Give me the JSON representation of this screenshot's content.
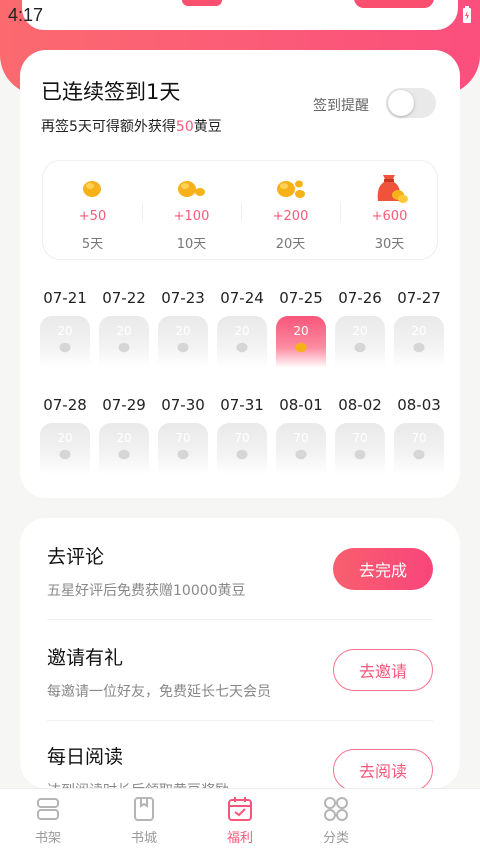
{
  "status_bar": {
    "time": "4:17"
  },
  "signin": {
    "title": "已连续签到1天",
    "subtitle_prefix": "再签5天可得额外获得",
    "subtitle_highlight": "50",
    "subtitle_suffix": "黄豆",
    "remind_label": "签到提醒",
    "remind_enabled": false,
    "rewards": [
      {
        "points": "+50",
        "days": "5天",
        "icon": "bean-small-icon"
      },
      {
        "points": "+100",
        "days": "10天",
        "icon": "bean-double-icon"
      },
      {
        "points": "+200",
        "days": "20天",
        "icon": "bean-triple-icon"
      },
      {
        "points": "+600",
        "days": "30天",
        "icon": "bean-bag-icon"
      }
    ],
    "calendar": [
      {
        "date": "07-21",
        "value": "20",
        "active": false
      },
      {
        "date": "07-22",
        "value": "20",
        "active": false
      },
      {
        "date": "07-23",
        "value": "20",
        "active": false
      },
      {
        "date": "07-24",
        "value": "20",
        "active": false
      },
      {
        "date": "07-25",
        "value": "20",
        "active": true
      },
      {
        "date": "07-26",
        "value": "20",
        "active": false
      },
      {
        "date": "07-27",
        "value": "20",
        "active": false
      },
      {
        "date": "07-28",
        "value": "20",
        "active": false
      },
      {
        "date": "07-29",
        "value": "20",
        "active": false
      },
      {
        "date": "07-30",
        "value": "70",
        "active": false
      },
      {
        "date": "07-31",
        "value": "70",
        "active": false
      },
      {
        "date": "08-01",
        "value": "70",
        "active": false
      },
      {
        "date": "08-02",
        "value": "70",
        "active": false
      },
      {
        "date": "08-03",
        "value": "70",
        "active": false
      }
    ]
  },
  "tasks": [
    {
      "title": "去评论",
      "desc": "五星好评后免费获赠10000黄豆",
      "button": "去完成",
      "style": "fill"
    },
    {
      "title": "邀请有礼",
      "desc": "每邀请一位好友，免费延长七天会员",
      "button": "去邀请",
      "style": "outline"
    },
    {
      "title": "每日阅读",
      "desc": "达到阅读时长后领取黄豆奖励",
      "button": "去阅读",
      "style": "outline"
    }
  ],
  "tabbar": [
    {
      "label": "书架",
      "icon": "bookshelf-icon",
      "active": false
    },
    {
      "label": "书城",
      "icon": "bookstore-icon",
      "active": false
    },
    {
      "label": "福利",
      "icon": "welfare-calendar-icon",
      "active": true
    },
    {
      "label": "分类",
      "icon": "category-grid-icon",
      "active": false
    }
  ],
  "colors": {
    "accent": "#fb5a78",
    "banner": "#fb5a74",
    "muted": "#999999"
  }
}
